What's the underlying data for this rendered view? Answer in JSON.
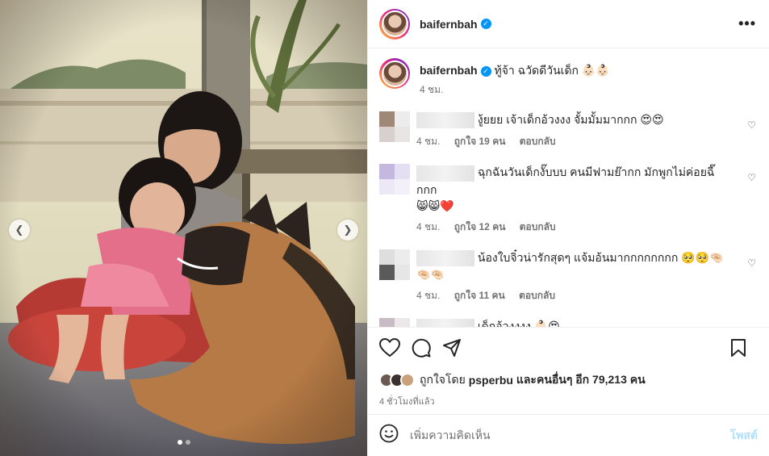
{
  "post": {
    "username": "baifernbah",
    "more_label": "•••",
    "caption_username": "baifernbah",
    "caption_text": "ทู้จ้า ฉวัดดีวันเด็ก 👶🏻👶🏻",
    "caption_time": "4 ชม."
  },
  "comments": [
    {
      "text": "งู้ยยย เจ้าเด็กอ้วงงง จั้มมั้มมากกก 😍😍",
      "time": "4 ชม.",
      "likes": "ถูกใจ 19 คน",
      "reply": "ตอบกลับ",
      "colors": [
        "#a08878",
        "#ececec",
        "#d8cfcf",
        "#e9e4e4"
      ]
    },
    {
      "text": "ฉุกฉันวันเด็กงั๊บบบ คนมีฟามย๊ากก มักพูกไม่ค่อยฉี๊กกก",
      "emoji": "😸😸❤️",
      "time": "4 ชม.",
      "likes": "ถูกใจ 12 คน",
      "reply": "ตอบกลับ",
      "colors": [
        "#c4b8e0",
        "#e4dff2",
        "#ece8f6",
        "#f3f0fa"
      ]
    },
    {
      "text": "น้องใบจิ๋วน่ารักสุดๆ แจ้มอ้นมากกกกกกกก 🥺🥺🤏🏻",
      "emoji": "🤏🏻🤏🏻",
      "time": "4 ชม.",
      "likes": "ถูกใจ 11 คน",
      "reply": "ตอบกลับ",
      "colors": [
        "#dedede",
        "#ececec",
        "#5a5a5a",
        "#e6e6e6"
      ]
    },
    {
      "text": "เด็กอ้วงงงง 👶🏻😍",
      "colors": [
        "#c8bcc4",
        "#ece8ea",
        "#e8c4d8",
        "#f0d8e4"
      ]
    }
  ],
  "actions": {
    "liked_by_prefix": "ถูกใจโดย",
    "liked_by_user": "psperbu",
    "liked_by_suffix": "และคนอื่นๆ อีก 79,213 คน",
    "time_ago": "4 ชั่วโมงที่แล้ว"
  },
  "compose": {
    "placeholder": "เพิ่มความคิดเห็น",
    "post_label": "โพสต์"
  },
  "colors": {
    "verified": "#0095f6",
    "post_disabled": "#b2dffc",
    "secondary_text": "#737373"
  }
}
